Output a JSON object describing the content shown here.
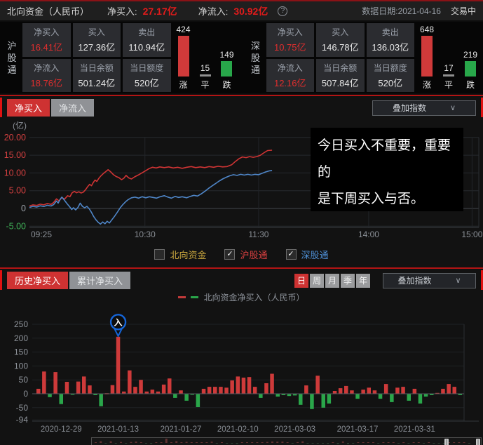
{
  "icons": {
    "chevron": "∨",
    "help": "?",
    "check": "✓",
    "marker_glyph": "入"
  },
  "header": {
    "title": "北向资金（人民币）",
    "net_buy_label": "净买入:",
    "net_buy_value": "27.17亿",
    "net_inflow_label": "净流入:",
    "net_inflow_value": "30.92亿",
    "data_date": "数据日期:2021-04-16",
    "market_status": "交易中"
  },
  "panels": [
    {
      "name_chars": [
        "沪",
        "股",
        "通"
      ],
      "cells": [
        {
          "label": "净买入",
          "value": "16.41亿"
        },
        {
          "label": "买入",
          "value": "127.36亿"
        },
        {
          "label": "卖出",
          "value": "110.94亿"
        },
        {
          "label": "净流入",
          "value": "18.76亿"
        },
        {
          "label": "当日余额",
          "value": "501.24亿"
        },
        {
          "label": "当日额度",
          "value": "520亿"
        }
      ],
      "updown": [
        {
          "label": "涨",
          "count": "424",
          "color": "red"
        },
        {
          "label": "平",
          "count": "15",
          "color": "gray"
        },
        {
          "label": "跌",
          "count": "149",
          "color": "green"
        }
      ]
    },
    {
      "name_chars": [
        "深",
        "股",
        "通"
      ],
      "cells": [
        {
          "label": "净买入",
          "value": "10.75亿"
        },
        {
          "label": "买入",
          "value": "146.78亿"
        },
        {
          "label": "卖出",
          "value": "136.03亿"
        },
        {
          "label": "净流入",
          "value": "12.16亿"
        },
        {
          "label": "当日余额",
          "value": "507.84亿"
        },
        {
          "label": "当日额度",
          "value": "520亿"
        }
      ],
      "updown": [
        {
          "label": "涨",
          "count": "648",
          "color": "red"
        },
        {
          "label": "平",
          "count": "17",
          "color": "gray"
        },
        {
          "label": "跌",
          "count": "219",
          "color": "green"
        }
      ]
    }
  ],
  "intraday": {
    "tabs": [
      "净买入",
      "净流入"
    ],
    "active_tab": "净买入",
    "overlay_select": "叠加指数",
    "annotation": {
      "line1": "今日买入不重要，重要的",
      "line2": "是下周买入与否。"
    },
    "checkboxes": [
      {
        "label": "北向资金",
        "checked": false,
        "color": "#c9a63e"
      },
      {
        "label": "沪股通",
        "checked": true,
        "color": "#d94040"
      },
      {
        "label": "深股通",
        "checked": true,
        "color": "#4e8fd5"
      }
    ]
  },
  "history": {
    "tabs": [
      "历史净买入",
      "累计净买入"
    ],
    "active_tab": "历史净买入",
    "periods": [
      "日",
      "周",
      "月",
      "季",
      "年"
    ],
    "active_period": "日",
    "overlay_select": "叠加指数",
    "legend": "北向资金净买入（人民币）"
  },
  "chart_data": [
    {
      "type": "line",
      "title": "北向资金当日分时净买入",
      "ylabel": "(亿)",
      "ylim": [
        -5,
        20
      ],
      "grid": true,
      "yticks": [
        {
          "v": 20,
          "label": "20.00",
          "color": "#d34040"
        },
        {
          "v": 15,
          "label": "15.00",
          "color": "#d34040"
        },
        {
          "v": 10,
          "label": "10.00",
          "color": "#d34040"
        },
        {
          "v": 5,
          "label": "5.00",
          "color": "#d34040"
        },
        {
          "v": 0,
          "label": "0",
          "color": "#9aa0a8"
        },
        {
          "v": -5,
          "label": "-5.00",
          "color": "#3fae57"
        }
      ],
      "xticks": [
        {
          "f": 0.0,
          "label": "09:25"
        },
        {
          "f": 0.257,
          "label": "10:30"
        },
        {
          "f": 0.51,
          "label": "11:30"
        },
        {
          "f": 0.755,
          "label": "14:00"
        },
        {
          "f": 0.985,
          "label": "15:00"
        }
      ],
      "series": [
        {
          "name": "沪股通",
          "color": "#cf3434",
          "last_value": 16.41,
          "points": [
            [
              0,
              0.7
            ],
            [
              0.008,
              1.0
            ],
            [
              0.016,
              0.85
            ],
            [
              0.024,
              1.2
            ],
            [
              0.032,
              1.0
            ],
            [
              0.04,
              1.4
            ],
            [
              0.048,
              1.15
            ],
            [
              0.054,
              1.7
            ],
            [
              0.06,
              2.7
            ],
            [
              0.066,
              2.1
            ],
            [
              0.072,
              3.1
            ],
            [
              0.078,
              2.6
            ],
            [
              0.085,
              3.6
            ],
            [
              0.09,
              3.3
            ],
            [
              0.095,
              4.4
            ],
            [
              0.1,
              4.8
            ],
            [
              0.105,
              4.4
            ],
            [
              0.11,
              4.7
            ],
            [
              0.115,
              4.35
            ],
            [
              0.12,
              4.6
            ],
            [
              0.125,
              5.3
            ],
            [
              0.13,
              6.2
            ],
            [
              0.134,
              6.8
            ],
            [
              0.138,
              6.4
            ],
            [
              0.142,
              7.3
            ],
            [
              0.146,
              8.0
            ],
            [
              0.15,
              7.6
            ],
            [
              0.155,
              8.6
            ],
            [
              0.16,
              9.3
            ],
            [
              0.165,
              9.9
            ],
            [
              0.17,
              10.4
            ],
            [
              0.175,
              10.9
            ],
            [
              0.181,
              10.3
            ],
            [
              0.187,
              9.5
            ],
            [
              0.193,
              9.0
            ],
            [
              0.199,
              8.7
            ],
            [
              0.205,
              8.1
            ],
            [
              0.21,
              8.5
            ],
            [
              0.215,
              9.3
            ],
            [
              0.221,
              8.6
            ],
            [
              0.227,
              8.3
            ],
            [
              0.234,
              8.9
            ],
            [
              0.242,
              9.4
            ],
            [
              0.25,
              10.0
            ],
            [
              0.258,
              10.6
            ],
            [
              0.266,
              11.2
            ],
            [
              0.274,
              11.6
            ],
            [
              0.282,
              11.4
            ],
            [
              0.29,
              11.7
            ],
            [
              0.3,
              11.5
            ],
            [
              0.31,
              11.7
            ],
            [
              0.32,
              11.4
            ],
            [
              0.33,
              11.6
            ],
            [
              0.34,
              11.3
            ],
            [
              0.35,
              11.6
            ],
            [
              0.36,
              11.8
            ],
            [
              0.37,
              11.5
            ],
            [
              0.38,
              11.7
            ],
            [
              0.39,
              11.5
            ],
            [
              0.4,
              11.8
            ],
            [
              0.41,
              11.6
            ],
            [
              0.42,
              11.9
            ],
            [
              0.43,
              11.7
            ],
            [
              0.44,
              11.8
            ],
            [
              0.45,
              12.3
            ],
            [
              0.458,
              13.2
            ],
            [
              0.466,
              14.0
            ],
            [
              0.474,
              14.5
            ],
            [
              0.482,
              14.3
            ],
            [
              0.49,
              14.6
            ],
            [
              0.498,
              14.4
            ],
            [
              0.506,
              14.6
            ],
            [
              0.514,
              15.0
            ],
            [
              0.522,
              15.7
            ],
            [
              0.53,
              16.3
            ],
            [
              0.54,
              16.4
            ]
          ]
        },
        {
          "name": "深股通",
          "color": "#4f86c8",
          "last_value": 10.75,
          "points": [
            [
              0,
              0.3
            ],
            [
              0.008,
              0.6
            ],
            [
              0.016,
              0.4
            ],
            [
              0.024,
              0.75
            ],
            [
              0.032,
              0.55
            ],
            [
              0.04,
              0.9
            ],
            [
              0.048,
              0.7
            ],
            [
              0.054,
              1.1
            ],
            [
              0.06,
              2.1
            ],
            [
              0.064,
              1.5
            ],
            [
              0.068,
              2.5
            ],
            [
              0.072,
              3.2
            ],
            [
              0.078,
              2.3
            ],
            [
              0.084,
              1.3
            ],
            [
              0.09,
              0.4
            ],
            [
              0.094,
              -0.3
            ],
            [
              0.098,
              0.2
            ],
            [
              0.103,
              -0.4
            ],
            [
              0.108,
              0.3
            ],
            [
              0.113,
              1.5
            ],
            [
              0.118,
              0.6
            ],
            [
              0.123,
              0.2
            ],
            [
              0.128,
              0.6
            ],
            [
              0.133,
              -0.1
            ],
            [
              0.138,
              -1.1
            ],
            [
              0.143,
              -2.3
            ],
            [
              0.148,
              -3.2
            ],
            [
              0.153,
              -3.9
            ],
            [
              0.158,
              -4.4
            ],
            [
              0.163,
              -3.8
            ],
            [
              0.168,
              -4.3
            ],
            [
              0.173,
              -3.6
            ],
            [
              0.178,
              -4.1
            ],
            [
              0.184,
              -3.1
            ],
            [
              0.19,
              -2.1
            ],
            [
              0.196,
              -1.0
            ],
            [
              0.202,
              0.2
            ],
            [
              0.208,
              1.1
            ],
            [
              0.214,
              1.9
            ],
            [
              0.22,
              2.5
            ],
            [
              0.227,
              3.0
            ],
            [
              0.235,
              3.2
            ],
            [
              0.243,
              2.9
            ],
            [
              0.251,
              3.3
            ],
            [
              0.259,
              3.0
            ],
            [
              0.267,
              3.3
            ],
            [
              0.275,
              3.1
            ],
            [
              0.283,
              2.9
            ],
            [
              0.291,
              3.3
            ],
            [
              0.3,
              3.6
            ],
            [
              0.308,
              3.2
            ],
            [
              0.316,
              2.9
            ],
            [
              0.324,
              3.4
            ],
            [
              0.332,
              3.1
            ],
            [
              0.34,
              3.3
            ],
            [
              0.35,
              3.0
            ],
            [
              0.358,
              3.4
            ],
            [
              0.366,
              3.7
            ],
            [
              0.374,
              3.5
            ],
            [
              0.382,
              4.1
            ],
            [
              0.39,
              4.8
            ],
            [
              0.398,
              5.6
            ],
            [
              0.406,
              6.3
            ],
            [
              0.414,
              7.0
            ],
            [
              0.422,
              7.7
            ],
            [
              0.43,
              8.3
            ],
            [
              0.438,
              8.8
            ],
            [
              0.446,
              9.2
            ],
            [
              0.454,
              9.5
            ],
            [
              0.462,
              9.3
            ],
            [
              0.47,
              9.6
            ],
            [
              0.478,
              9.4
            ],
            [
              0.486,
              9.6
            ],
            [
              0.494,
              9.4
            ],
            [
              0.502,
              9.6
            ],
            [
              0.51,
              9.5
            ],
            [
              0.518,
              9.9
            ],
            [
              0.526,
              10.3
            ],
            [
              0.534,
              10.6
            ],
            [
              0.54,
              10.7
            ]
          ]
        }
      ]
    },
    {
      "type": "bar",
      "title": "北向资金净买入（人民币）",
      "ylim": [
        -94,
        250
      ],
      "grid": true,
      "yticks": [
        {
          "v": 250,
          "label": "250"
        },
        {
          "v": 200,
          "label": "200"
        },
        {
          "v": 150,
          "label": "150"
        },
        {
          "v": 100,
          "label": "100"
        },
        {
          "v": 50,
          "label": "50"
        },
        {
          "v": 0,
          "label": "0"
        },
        {
          "v": -50,
          "label": "-50"
        },
        {
          "v": -94,
          "label": "-94"
        }
      ],
      "pos_color": "#ce3a3a",
      "neg_color": "#2aa64a",
      "values": [
        18,
        80,
        -12,
        78,
        -37,
        43,
        -3,
        44,
        62,
        30,
        -5,
        -45,
        2,
        31,
        205,
        8,
        84,
        25,
        50,
        8,
        15,
        8,
        33,
        55,
        -15,
        12,
        -25,
        -3,
        -48,
        18,
        25,
        25,
        25,
        22,
        48,
        62,
        58,
        60,
        25,
        -15,
        38,
        72,
        -10,
        -5,
        -8,
        -6,
        -40,
        30,
        -55,
        65,
        -50,
        -35,
        10,
        20,
        28,
        12,
        -18,
        15,
        22,
        12,
        -18,
        35,
        -30,
        22,
        25,
        -25,
        18,
        -35,
        -10,
        -5,
        3,
        18,
        35,
        25,
        -5
      ],
      "marker": {
        "index": 14,
        "glyph": "入",
        "color": "#1565d8",
        "value": 205
      },
      "xticks": [
        {
          "i": 4,
          "label": "2020-12-29"
        },
        {
          "i": 14,
          "label": "2021-01-13"
        },
        {
          "i": 25,
          "label": "2021-01-27"
        },
        {
          "i": 35,
          "label": "2021-02-10"
        },
        {
          "i": 45,
          "label": "2021-03-03"
        },
        {
          "i": 56,
          "label": "2021-03-17"
        },
        {
          "i": 66,
          "label": "2021-03-31"
        }
      ]
    }
  ]
}
